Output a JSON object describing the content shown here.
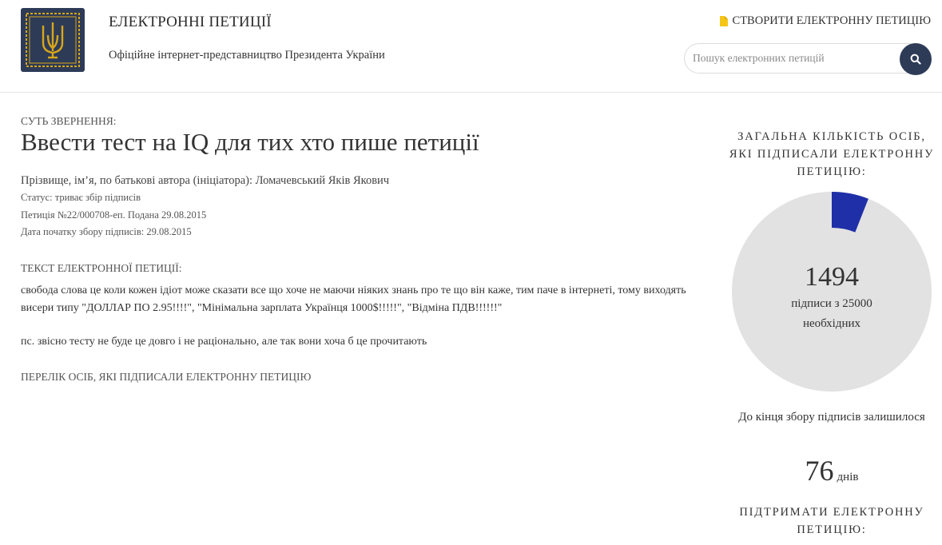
{
  "header": {
    "site_title": "ЕЛЕКТРОННІ ПЕТИЦІЇ",
    "site_subtitle": "Офіційне інтернет-представництво Президента України",
    "create_link": "СТВОРИТИ ЕЛЕКТРОННУ ПЕТИЦІЮ",
    "search_placeholder": "Пошук електронних петицій",
    "logo_icon": "trident-icon",
    "create_icon": "document-icon",
    "search_icon": "search-icon"
  },
  "petition": {
    "essence_label": "СУТЬ ЗВЕРНЕННЯ:",
    "title": "Ввести тест на IQ для тих хто пише петиції",
    "author": "Прізвище, ім’я, по батькові автора (ініціатора): Ломачевський Яків Якович",
    "status": "Статус: триває збір підписів",
    "number": "Петиція №22/000708-еп. Подана 29.08.2015",
    "start_date": "Дата початку збору підписів: 29.08.2015",
    "text_label": "ТЕКСТ ЕЛЕКТРОННОЇ ПЕТИЦІЇ:",
    "body": "свобода слова це коли кожен ідіот може сказати все що хоче не маючи ніяких знань про те що він каже, тим паче в інтернеті, тому виходять висери типу \"ДОЛЛАР ПО 2.95!!!!\", \"Мінімальна зарплата Українця 1000$!!!!!\", \"Відміна ПДВ!!!!!!\"",
    "ps": "пс. звісно тесту не буде це довго і не раціонально, але так вони хоча б це прочитають",
    "signers_link": "ПЕРЕЛІК ОСІБ, ЯКІ ПІДПИСАЛИ ЕЛЕКТРОННУ ПЕТИЦІЮ"
  },
  "sidebar": {
    "total_label": "ЗАГАЛЬНА КІЛЬКІСТЬ ОСІБ, ЯКІ ПІДПИСАЛИ ЕЛЕКТРОННУ ПЕТИЦІЮ:",
    "count": "1494",
    "count_caption": "підписи з 25000 необхідних",
    "signatures": 1494,
    "required": 25000,
    "remaining_label": "До кінця збору підписів залишилося",
    "days": "76",
    "days_unit": "днів",
    "support_label": "ПІДТРИМАТИ ЕЛЕКТРОННУ ПЕТИЦІЮ:",
    "progress_color": "#1f2fa8",
    "track_color": "#e2e2e2"
  },
  "colors": {
    "brand": "#2d3b57",
    "logo_gold": "#d9a61a",
    "accent_yellow": "#f5c518"
  }
}
